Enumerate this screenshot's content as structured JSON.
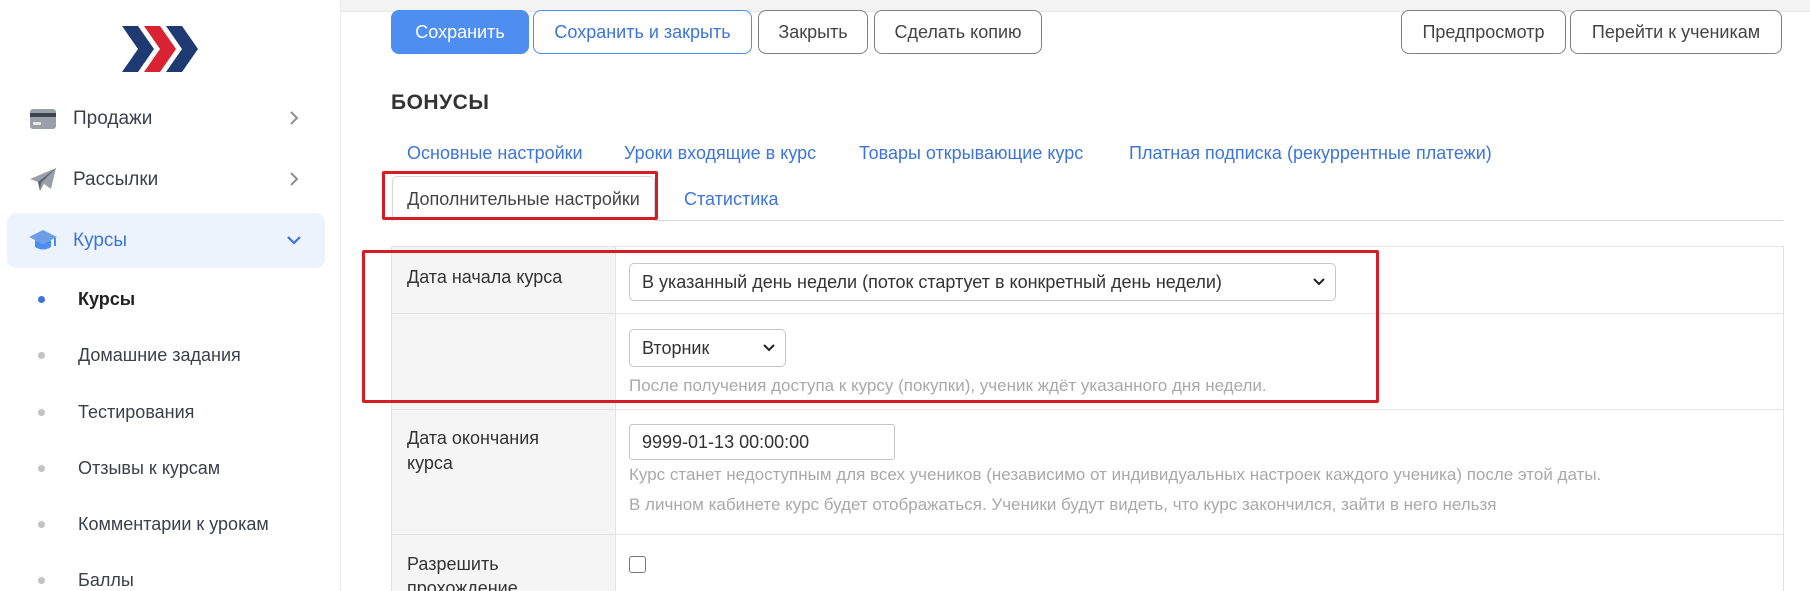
{
  "toolbar": {
    "save": "Сохранить",
    "save_close": "Сохранить и закрыть",
    "close": "Закрыть",
    "copy": "Сделать копию",
    "preview": "Предпросмотр",
    "goto_students": "Перейти к ученикам"
  },
  "sidebar": {
    "items": [
      {
        "label": "Продажи",
        "icon": "credit-card-icon"
      },
      {
        "label": "Рассылки",
        "icon": "paper-plane-icon"
      },
      {
        "label": "Курсы",
        "icon": "graduation-cap-icon"
      }
    ],
    "subitems": [
      {
        "label": "Курсы"
      },
      {
        "label": "Домашние задания"
      },
      {
        "label": "Тестирования"
      },
      {
        "label": "Отзывы к курсам"
      },
      {
        "label": "Комментарии к урокам"
      },
      {
        "label": "Баллы"
      }
    ]
  },
  "page": {
    "title": "БОНУСЫ"
  },
  "tabs": {
    "main_settings": "Основные настройки",
    "lessons": "Уроки входящие в курс",
    "products": "Товары открывающие курс",
    "subscription": "Платная подписка (рекуррентные платежи)",
    "additional": "Дополнительные настройки",
    "stats": "Статистика"
  },
  "form": {
    "start_date_label": "Дата начала курса",
    "start_mode_value": "В указанный день недели (поток стартует в конкретный день недели)",
    "weekday_value": "Вторник",
    "weekday_hint": "После получения доступа к курсу (покупки), ученик ждёт указанного дня недели.",
    "end_date_label_1": "Дата окончания",
    "end_date_label_2": "курса",
    "end_date_value": "9999-01-13 00:00:00",
    "end_hint_1": "Курс станет недоступным для всех учеников (независимо от индивидуальных настроек каждого ученика) после этой даты.",
    "end_hint_2": "В личном кабинете курс будет отображаться. Ученики будут видеть, что курс закончился, зайти в него нельзя",
    "allow_label_1": "Разрешить",
    "allow_label_2": "прохождение"
  },
  "colors": {
    "accent": "#4e8ef0",
    "link": "#3d74d9",
    "highlight": "#d61c24",
    "logo_dark": "#1f3a73",
    "logo_red": "#d92332"
  }
}
